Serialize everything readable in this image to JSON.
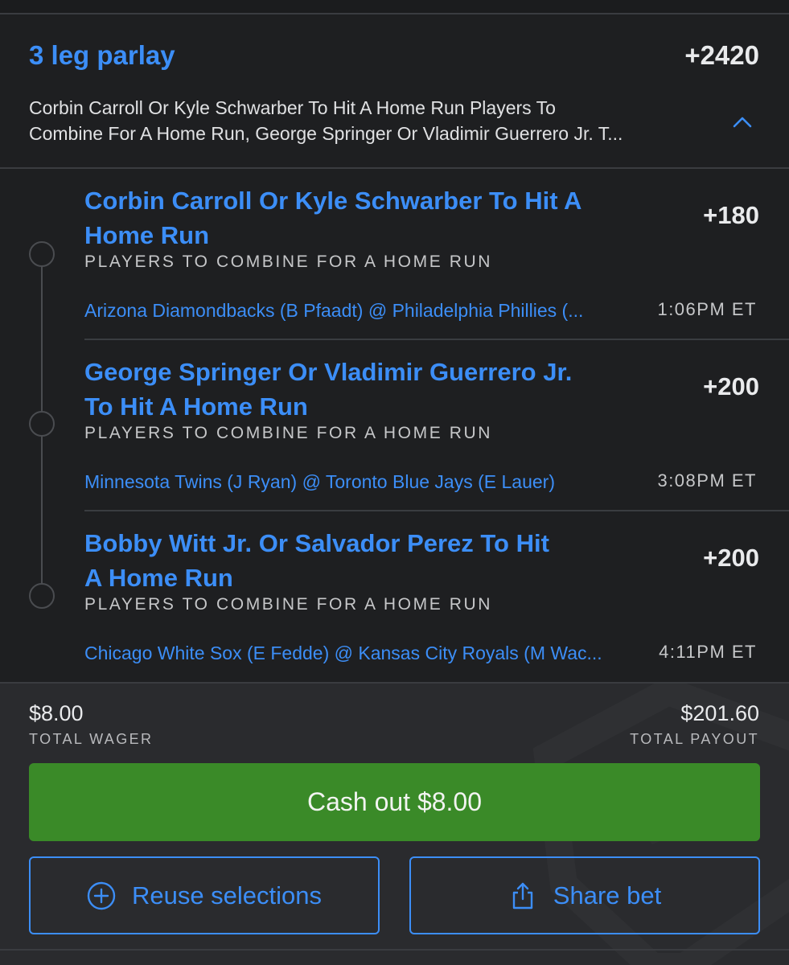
{
  "parlay": {
    "title": "3 leg parlay",
    "odds": "+2420",
    "description": "Corbin Carroll Or Kyle Schwarber To Hit A Home Run Players To\nCombine For A Home Run, George Springer Or Vladimir Guerrero Jr. T...",
    "collapse_icon": "chevron-up-icon"
  },
  "legs": [
    {
      "title": "Corbin Carroll Or Kyle Schwarber To Hit A Home Run",
      "odds": "+180",
      "market": "PLAYERS TO COMBINE FOR A HOME RUN",
      "game": "Arizona Diamondbacks (B Pfaadt) @ Philadelphia Phillies (...",
      "time": "1:06PM ET"
    },
    {
      "title": "George Springer Or Vladimir Guerrero Jr. To Hit A Home Run",
      "odds": "+200",
      "market": "PLAYERS TO COMBINE FOR A HOME RUN",
      "game": "Minnesota Twins (J Ryan) @ Toronto Blue Jays (E Lauer)",
      "time": "3:08PM ET"
    },
    {
      "title": "Bobby Witt Jr. Or Salvador Perez To Hit A Home Run",
      "odds": "+200",
      "market": "PLAYERS TO COMBINE FOR A HOME RUN",
      "game": "Chicago White Sox (E Fedde) @ Kansas City Royals (M Wac...",
      "time": "4:11PM ET"
    }
  ],
  "summary": {
    "wager_value": "$8.00",
    "wager_label": "TOTAL WAGER",
    "payout_value": "$201.60",
    "payout_label": "TOTAL PAYOUT"
  },
  "actions": {
    "cashout_label": "Cash out $8.00",
    "reuse_label": "Reuse selections",
    "reuse_icon": "plus-circle-icon",
    "share_label": "Share bet",
    "share_icon": "share-icon"
  },
  "colors": {
    "accent": "#3c8ef7",
    "cashout": "#3a8a28",
    "background": "#1e1f21"
  }
}
